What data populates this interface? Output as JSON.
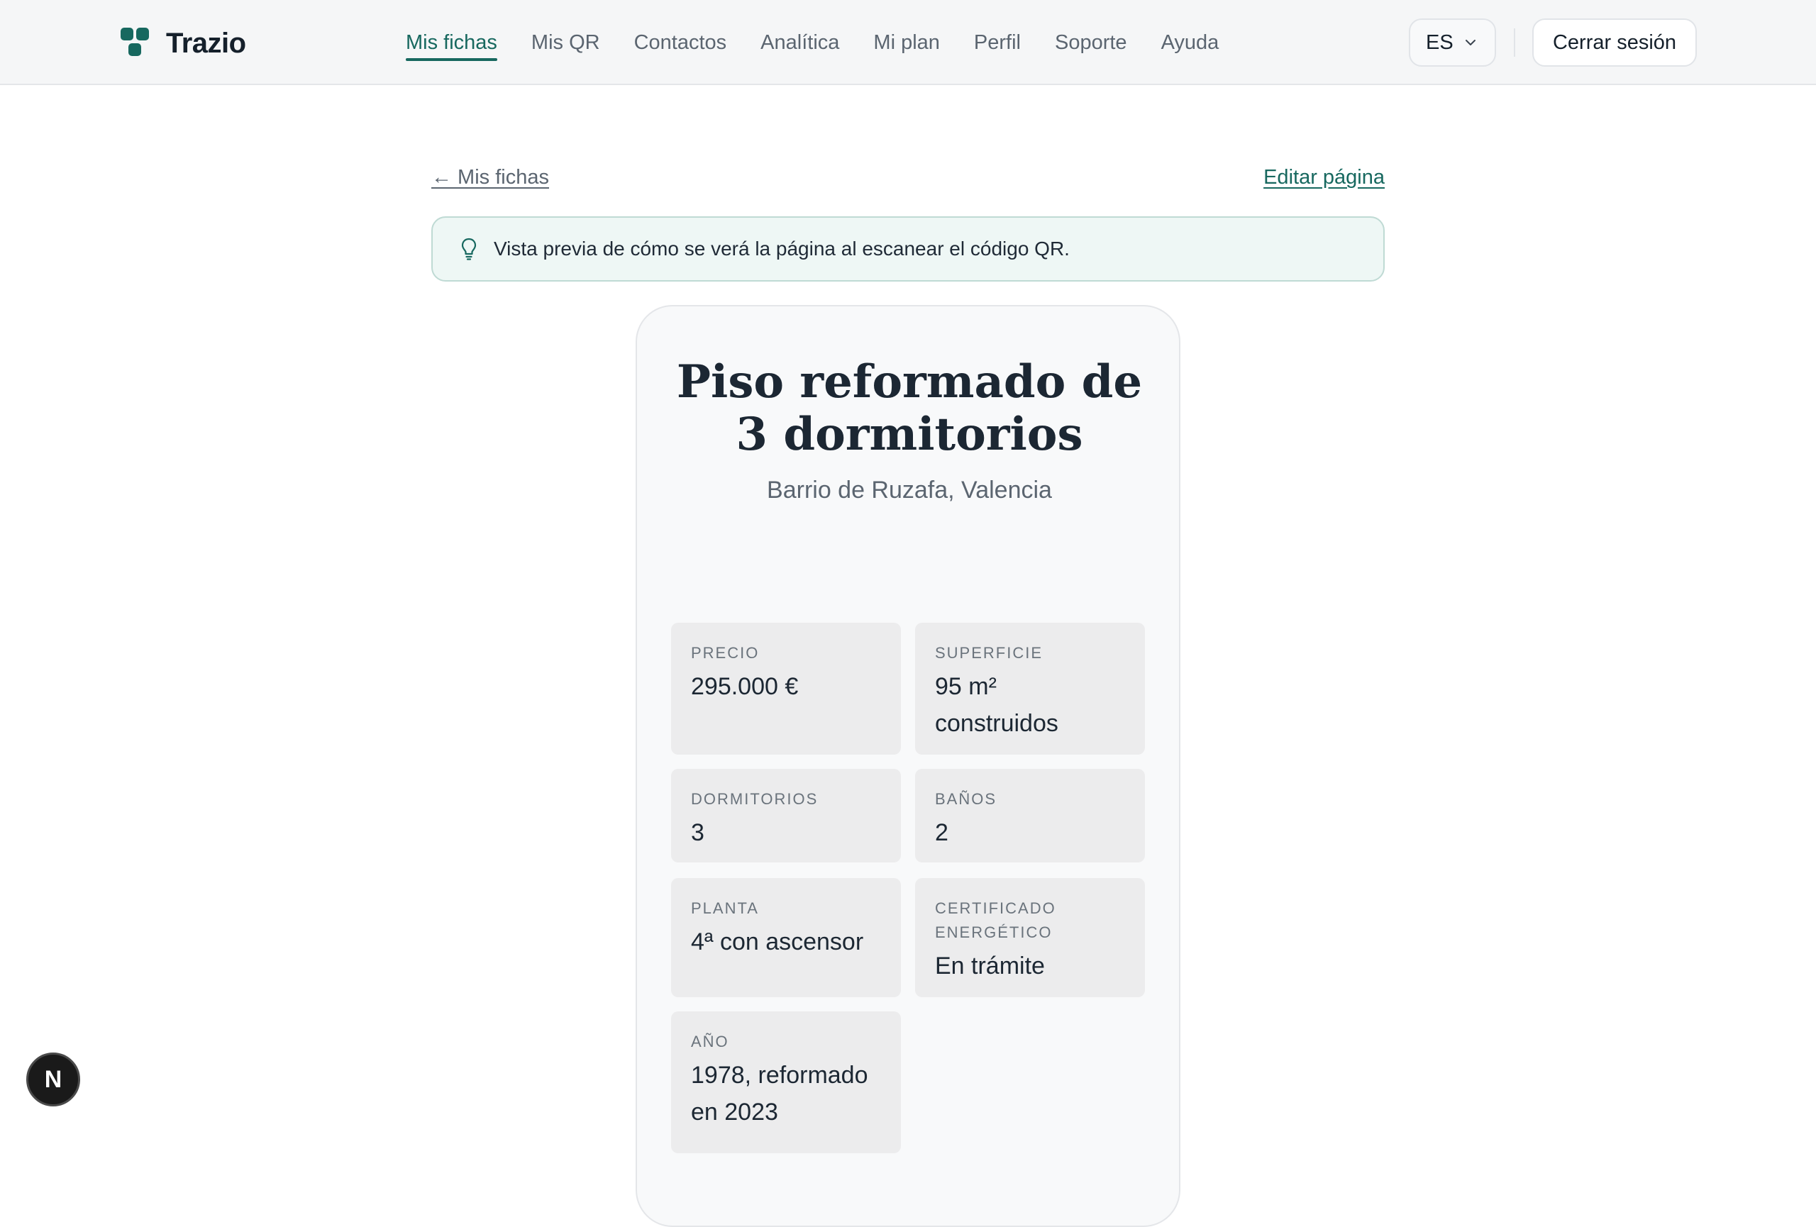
{
  "brand": {
    "name": "Trazio",
    "accent": "#17685f"
  },
  "nav": {
    "items": [
      {
        "label": "Mis fichas",
        "active": true
      },
      {
        "label": "Mis QR",
        "active": false
      },
      {
        "label": "Contactos",
        "active": false
      },
      {
        "label": "Analítica",
        "active": false
      },
      {
        "label": "Mi plan",
        "active": false
      },
      {
        "label": "Perfil",
        "active": false
      },
      {
        "label": "Soporte",
        "active": false
      },
      {
        "label": "Ayuda",
        "active": false
      }
    ]
  },
  "language": {
    "selected": "ES",
    "icon": "chevron-down-icon"
  },
  "logout_label": "Cerrar sesión",
  "page": {
    "back_label": "← Mis fichas",
    "edit_label": "Editar página",
    "banner": {
      "icon": "lightbulb-icon",
      "text": "Vista previa de cómo se verá la página al escanear el código QR."
    }
  },
  "listing": {
    "title": "Piso reformado de 3 dormitorios",
    "location": "Barrio de Ruzafa, Valencia",
    "specs": [
      {
        "label": "PRECIO",
        "value": "295.000 €"
      },
      {
        "label": "SUPERFICIE",
        "value": "95 m² construidos"
      },
      {
        "label": "DORMITORIOS",
        "value": "3"
      },
      {
        "label": "BAÑOS",
        "value": "2"
      },
      {
        "label": "PLANTA",
        "value": "4ª con ascensor"
      },
      {
        "label": "CERTIFICADO ENERGÉTICO",
        "value": "En trámite"
      },
      {
        "label": "AÑO",
        "value": "1978, reformado en 2023"
      }
    ]
  },
  "dev_badge": {
    "letter": "N"
  }
}
